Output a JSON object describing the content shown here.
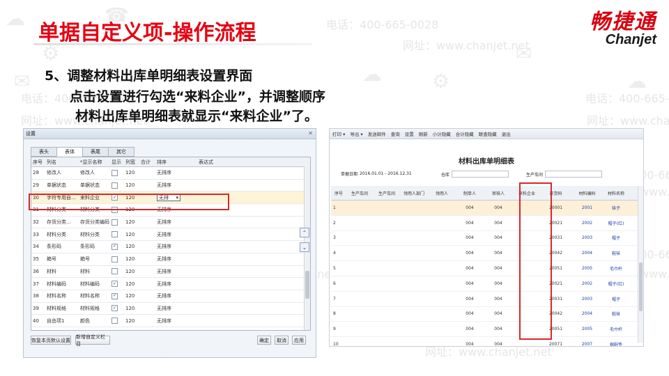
{
  "slide": {
    "title": "单据自定义项-操作流程",
    "step_line1": "5、调整材料出库单明细表设置界面",
    "step_line2": "点击设置进行勾选“来料企业”，并调整顺序",
    "step_line3": "材料出库单明细表就显示“来料企业”了。"
  },
  "brand": {
    "cn": "畅捷通",
    "en": "Chanjet"
  },
  "watermark": {
    "phone": "电话：400-665-0028",
    "site": "网址：www.chanjet.net"
  },
  "settings_dialog": {
    "title": "设置",
    "close": "✕",
    "tabs": [
      "表头",
      "表体",
      "表尾",
      "其它"
    ],
    "active_tab": 1,
    "columns": [
      "序号",
      "列名",
      "*显示名称",
      "显示",
      "列宽",
      "合计",
      "排序",
      "表达式"
    ],
    "rows": [
      {
        "no": "28",
        "name": "修改人",
        "display": "修改人",
        "show": false,
        "width": "120",
        "sort": "无排序"
      },
      {
        "no": "29",
        "name": "单据状态",
        "display": "单据状态",
        "show": false,
        "width": "120",
        "sort": "无排序"
      },
      {
        "no": "30",
        "name": "字符专用自…",
        "display": "来料企业",
        "show": true,
        "width": "120",
        "sort": "无排",
        "highlight": true
      },
      {
        "no": "31",
        "name": "材料分类",
        "display": "材料分类",
        "show": false,
        "width": "120",
        "sort": "无排序"
      },
      {
        "no": "32",
        "name": "存货分类…",
        "display": "存货分类编码",
        "show": false,
        "width": "120",
        "sort": "无排序"
      },
      {
        "no": "33",
        "name": "材料分类",
        "display": "材料分类",
        "show": false,
        "width": "120",
        "sort": "无排序"
      },
      {
        "no": "34",
        "name": "条形码",
        "display": "条形码",
        "show": true,
        "width": "120",
        "sort": "无排序"
      },
      {
        "no": "35",
        "name": "箱号",
        "display": "箱号",
        "show": false,
        "width": "120",
        "sort": "无排序"
      },
      {
        "no": "36",
        "name": "材料",
        "display": "材料",
        "show": false,
        "width": "120",
        "sort": "无排序"
      },
      {
        "no": "37",
        "name": "材料编码",
        "display": "材料编码",
        "show": true,
        "width": "120",
        "sort": "无排序"
      },
      {
        "no": "38",
        "name": "材料名称",
        "display": "材料名称",
        "show": true,
        "width": "120",
        "sort": "无排序"
      },
      {
        "no": "39",
        "name": "材料规格",
        "display": "材料规格",
        "show": true,
        "width": "120",
        "sort": "无排序"
      },
      {
        "no": "40",
        "name": "自由项1",
        "display": "颜色",
        "show": false,
        "width": "120",
        "sort": "无排序"
      }
    ],
    "move_up": "⌃",
    "move_down": "⌄",
    "buttons": {
      "restore": "恢复本页默认设置",
      "add_custom": "新增自定义栏目",
      "ok": "确定",
      "cancel": "取消",
      "apply": "应用"
    }
  },
  "report": {
    "toolbar": [
      "打印 ▾",
      "导出 ▾",
      "发送邮件",
      "查询",
      "设置",
      "刷新",
      "小计隐藏",
      "合计隐藏",
      "联查隐藏",
      "退出"
    ],
    "title": "材料出库单明细表",
    "filters": {
      "date_label": "单据日期",
      "date_value": "2016.01.01 - 2016.12.31",
      "warehouse_label": "仓库",
      "workshop_label": "生产车间"
    },
    "columns": [
      "序号",
      "生产车间",
      "生产车间",
      "领用人部门",
      "领用人",
      "制单人",
      "审核人",
      "来料企业",
      "存货码",
      "材料编码",
      "材料名称"
    ],
    "rows": [
      {
        "no": "1",
        "maker": "004",
        "auditor": "004",
        "inv": "20001",
        "code": "2001",
        "name": "袜子"
      },
      {
        "no": "2",
        "maker": "004",
        "auditor": "004",
        "inv": "20021",
        "code": "2002",
        "name": "帽子(红)"
      },
      {
        "no": "3",
        "maker": "004",
        "auditor": "004",
        "inv": "20031",
        "code": "2003",
        "name": "帽子"
      },
      {
        "no": "4",
        "maker": "004",
        "auditor": "004",
        "inv": "20042",
        "code": "2004",
        "name": "鞋袜"
      },
      {
        "no": "5",
        "maker": "004",
        "auditor": "004",
        "inv": "20051",
        "code": "2005",
        "name": "毛巾杆"
      },
      {
        "no": "6",
        "maker": "004",
        "auditor": "004",
        "inv": "20021",
        "code": "2002",
        "name": "帽子(红)"
      },
      {
        "no": "7",
        "maker": "004",
        "auditor": "004",
        "inv": "20031",
        "code": "2003",
        "name": "帽子"
      },
      {
        "no": "8",
        "maker": "004",
        "auditor": "004",
        "inv": "20042",
        "code": "2004",
        "name": "鞋袜"
      },
      {
        "no": "9",
        "maker": "004",
        "auditor": "004",
        "inv": "20051",
        "code": "2005",
        "name": "毛巾杆"
      },
      {
        "no": "10",
        "maker": "004",
        "auditor": "004",
        "inv": "20071",
        "code": "2007",
        "name": "棉鞋垫"
      }
    ]
  },
  "colors": {
    "title_red": "#e60012",
    "brand_red": "#d7000f",
    "highlight_border": "#d9262b",
    "row_highlight": "#fdf3d7"
  }
}
